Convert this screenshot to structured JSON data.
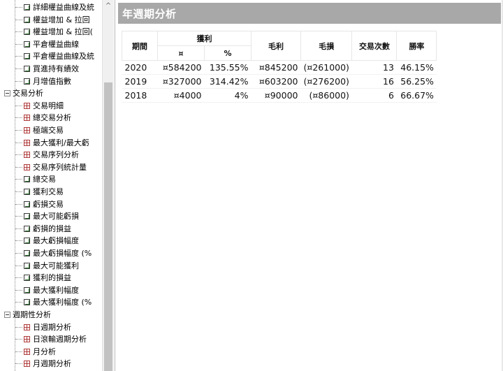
{
  "tree": {
    "items": [
      {
        "label": "詳細權益曲線及統",
        "type": "chart",
        "level": 2
      },
      {
        "label": "權益增加 & 拉回",
        "type": "chart",
        "level": 2
      },
      {
        "label": "權益增加 & 拉回(",
        "type": "chart",
        "level": 2
      },
      {
        "label": "平倉權益曲線",
        "type": "chart",
        "level": 2
      },
      {
        "label": "平倉權益曲線及統",
        "type": "chart",
        "level": 2
      },
      {
        "label": "買進持有績效",
        "type": "chart",
        "level": 2
      },
      {
        "label": "月增值指數",
        "type": "chart",
        "level": 2
      },
      {
        "label": "交易分析",
        "type": "group",
        "level": 1
      },
      {
        "label": "交易明細",
        "type": "table",
        "level": 2
      },
      {
        "label": "總交易分析",
        "type": "table",
        "level": 2
      },
      {
        "label": "極端交易",
        "type": "table",
        "level": 2
      },
      {
        "label": "最大獲利/最大虧",
        "type": "table",
        "level": 2
      },
      {
        "label": "交易序列分析",
        "type": "table",
        "level": 2
      },
      {
        "label": "交易序列統計量",
        "type": "table",
        "level": 2
      },
      {
        "label": "總交易",
        "type": "chart",
        "level": 2
      },
      {
        "label": "獲利交易",
        "type": "chart",
        "level": 2
      },
      {
        "label": "虧損交易",
        "type": "chart",
        "level": 2
      },
      {
        "label": "最大可能虧損",
        "type": "chart",
        "level": 2
      },
      {
        "label": "虧損的損益",
        "type": "chart",
        "level": 2
      },
      {
        "label": "最大虧損幅度",
        "type": "chart",
        "level": 2
      },
      {
        "label": "最大虧損幅度 (%",
        "type": "chart",
        "level": 2
      },
      {
        "label": "最大可能獲利",
        "type": "chart",
        "level": 2
      },
      {
        "label": "獲利的損益",
        "type": "chart",
        "level": 2
      },
      {
        "label": "最大獲利幅度",
        "type": "chart",
        "level": 2
      },
      {
        "label": "最大獲利幅度 (%",
        "type": "chart",
        "level": 2
      },
      {
        "label": "週期性分析",
        "type": "group",
        "level": 1
      },
      {
        "label": "日週期分析",
        "type": "table",
        "level": 2
      },
      {
        "label": "日滾輸週期分析",
        "type": "table",
        "level": 2
      },
      {
        "label": "月分析",
        "type": "table",
        "level": 2
      },
      {
        "label": "月週期分析",
        "type": "table",
        "level": 2
      }
    ]
  },
  "scroll_up_glyph": "^",
  "page": {
    "title": "年週期分析"
  },
  "table": {
    "headers": {
      "period": "期間",
      "profit": "獲利",
      "profit_amount": "¤",
      "profit_pct": "%",
      "gross_profit": "毛利",
      "gross_loss": "毛損",
      "trade_count": "交易次數",
      "win_rate": "勝率"
    },
    "rows": [
      {
        "period": "2020",
        "profit_amount": "¤584200",
        "profit_pct": "135.55%",
        "gross_profit": "¤845200",
        "gross_loss": "(¤261000)",
        "trade_count": "13",
        "win_rate": "46.15%"
      },
      {
        "period": "2019",
        "profit_amount": "¤327000",
        "profit_pct": "314.42%",
        "gross_profit": "¤603200",
        "gross_loss": "(¤276200)",
        "trade_count": "16",
        "win_rate": "56.25%"
      },
      {
        "period": "2018",
        "profit_amount": "¤4000",
        "profit_pct": "4%",
        "gross_profit": "¤90000",
        "gross_loss": "(¤86000)",
        "trade_count": "6",
        "win_rate": "66.67%"
      }
    ]
  },
  "colors": {
    "header_bg": "#a8a8a8",
    "loss_red": "#e23b3b"
  }
}
